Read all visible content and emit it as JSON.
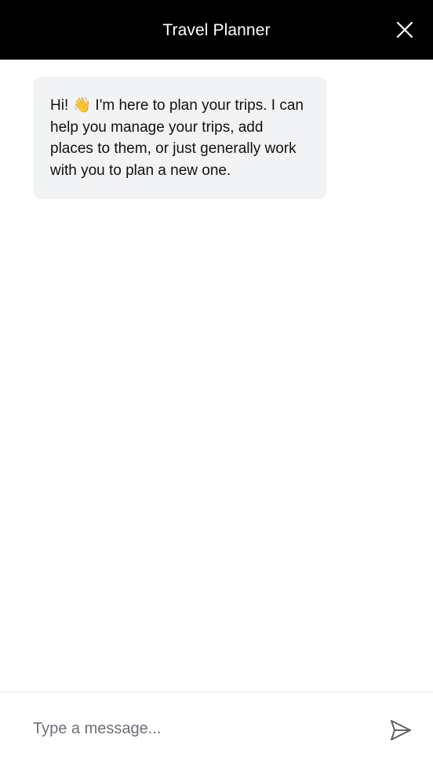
{
  "header": {
    "title": "Travel Planner",
    "close_icon": "close-icon"
  },
  "conversation": {
    "messages": [
      {
        "role": "assistant",
        "text": "Hi! 👋 I'm here to plan your trips. I can help you manage your trips, add places to them, or just generally work with you to plan a new one."
      }
    ]
  },
  "composer": {
    "placeholder": "Type a message...",
    "value": "",
    "send_icon": "send-icon"
  },
  "colors": {
    "header_bg": "#000000",
    "header_text": "#ffffff",
    "assistant_bubble_bg": "#f2f3f5",
    "composer_border": "#e6e7ea",
    "placeholder": "#6b6f76"
  }
}
